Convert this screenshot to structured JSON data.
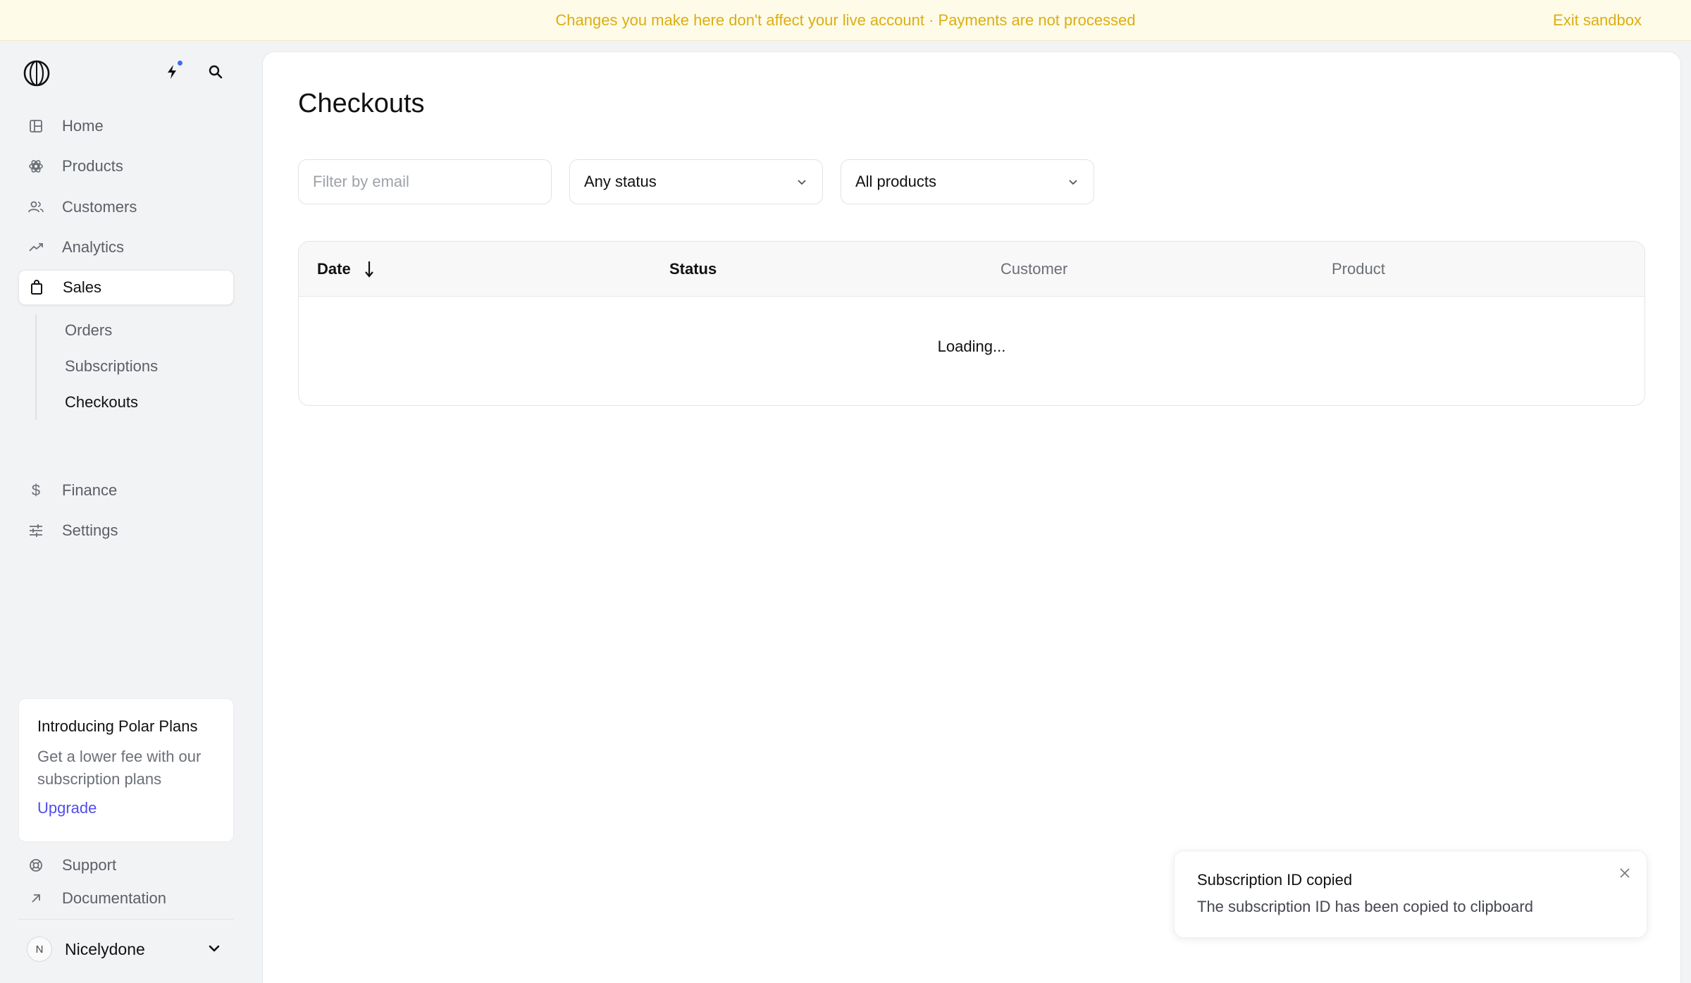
{
  "banner": {
    "message": "Changes you make here don't affect your live account · Payments are not processed",
    "exit_label": "Exit sandbox",
    "color": "#dcae12"
  },
  "sidebar": {
    "items": [
      {
        "label": "Home",
        "icon": "home-icon"
      },
      {
        "label": "Products",
        "icon": "products-icon"
      },
      {
        "label": "Customers",
        "icon": "customers-icon"
      },
      {
        "label": "Analytics",
        "icon": "analytics-icon"
      },
      {
        "label": "Sales",
        "icon": "bag-icon",
        "active": true
      },
      {
        "label": "Finance",
        "icon": "dollar-icon"
      },
      {
        "label": "Settings",
        "icon": "sliders-icon"
      }
    ],
    "sub_items": [
      {
        "label": "Orders"
      },
      {
        "label": "Subscriptions"
      },
      {
        "label": "Checkouts",
        "current": true
      }
    ],
    "promo": {
      "title": "Introducing Polar Plans",
      "body": "Get a lower fee with our subscription plans",
      "link": "Upgrade"
    },
    "footer": [
      {
        "label": "Support",
        "icon": "lifebuoy-icon"
      },
      {
        "label": "Documentation",
        "icon": "arrow-up-right-icon"
      }
    ],
    "account": {
      "initial": "N",
      "name": "Nicelydone"
    }
  },
  "main": {
    "title": "Checkouts",
    "filters": {
      "email_placeholder": "Filter by email",
      "status_value": "Any status",
      "product_value": "All products"
    },
    "table": {
      "columns": [
        "Date",
        "Status",
        "Customer",
        "Product"
      ],
      "loading_text": "Loading..."
    }
  },
  "toast": {
    "title": "Subscription ID copied",
    "body": "The subscription ID has been copied to clipboard"
  },
  "colors": {
    "accent_link": "#4f4df0",
    "notification_dot": "#3b6ef5"
  }
}
